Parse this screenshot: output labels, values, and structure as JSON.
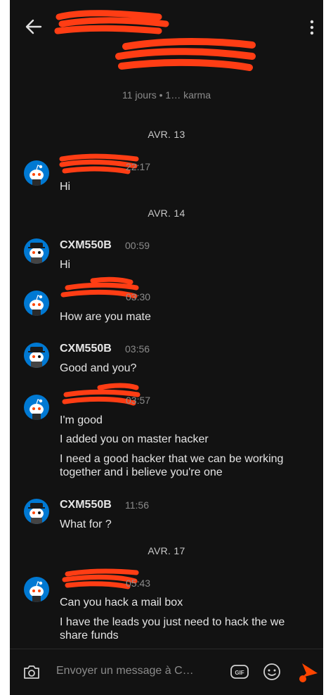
{
  "header": {
    "meta": "11 jours  •  1… karma"
  },
  "dates": {
    "d1": "AVR. 13",
    "d2": "AVR. 14",
    "d3": "AVR. 17"
  },
  "messages": {
    "m1": {
      "time": "22:17",
      "lines": [
        "Hi"
      ]
    },
    "m2": {
      "name": "CXM550B",
      "time": "00:59",
      "lines": [
        "Hi"
      ]
    },
    "m3": {
      "time": "03:30",
      "lines": [
        "How are you mate"
      ]
    },
    "m4": {
      "name": "CXM550B",
      "time": "03:56",
      "lines": [
        "Good and you?"
      ]
    },
    "m5": {
      "time": "03:57",
      "lines": [
        "I'm good",
        "I added you on master hacker",
        "I need a good hacker that we can be working",
        "together and i believe you're one"
      ]
    },
    "m6": {
      "name": "CXM550B",
      "time": "11:56",
      "lines": [
        "What for ?"
      ]
    },
    "m7": {
      "time": "05:43",
      "lines": [
        "Can you hack a mail box",
        "I have the leads you just need to hack the we",
        "share funds"
      ]
    }
  },
  "composer": {
    "placeholder": "Envoyer un message à C…",
    "gif_label": "GIF"
  },
  "colors": {
    "background": "#121212",
    "accent": "#ff4500",
    "avatar": "#0079d3",
    "redaction": "#ff3d14"
  },
  "icons": [
    "back-arrow-icon",
    "kebab-menu-icon",
    "camera-icon",
    "gif-icon",
    "emoji-icon",
    "send-icon"
  ]
}
